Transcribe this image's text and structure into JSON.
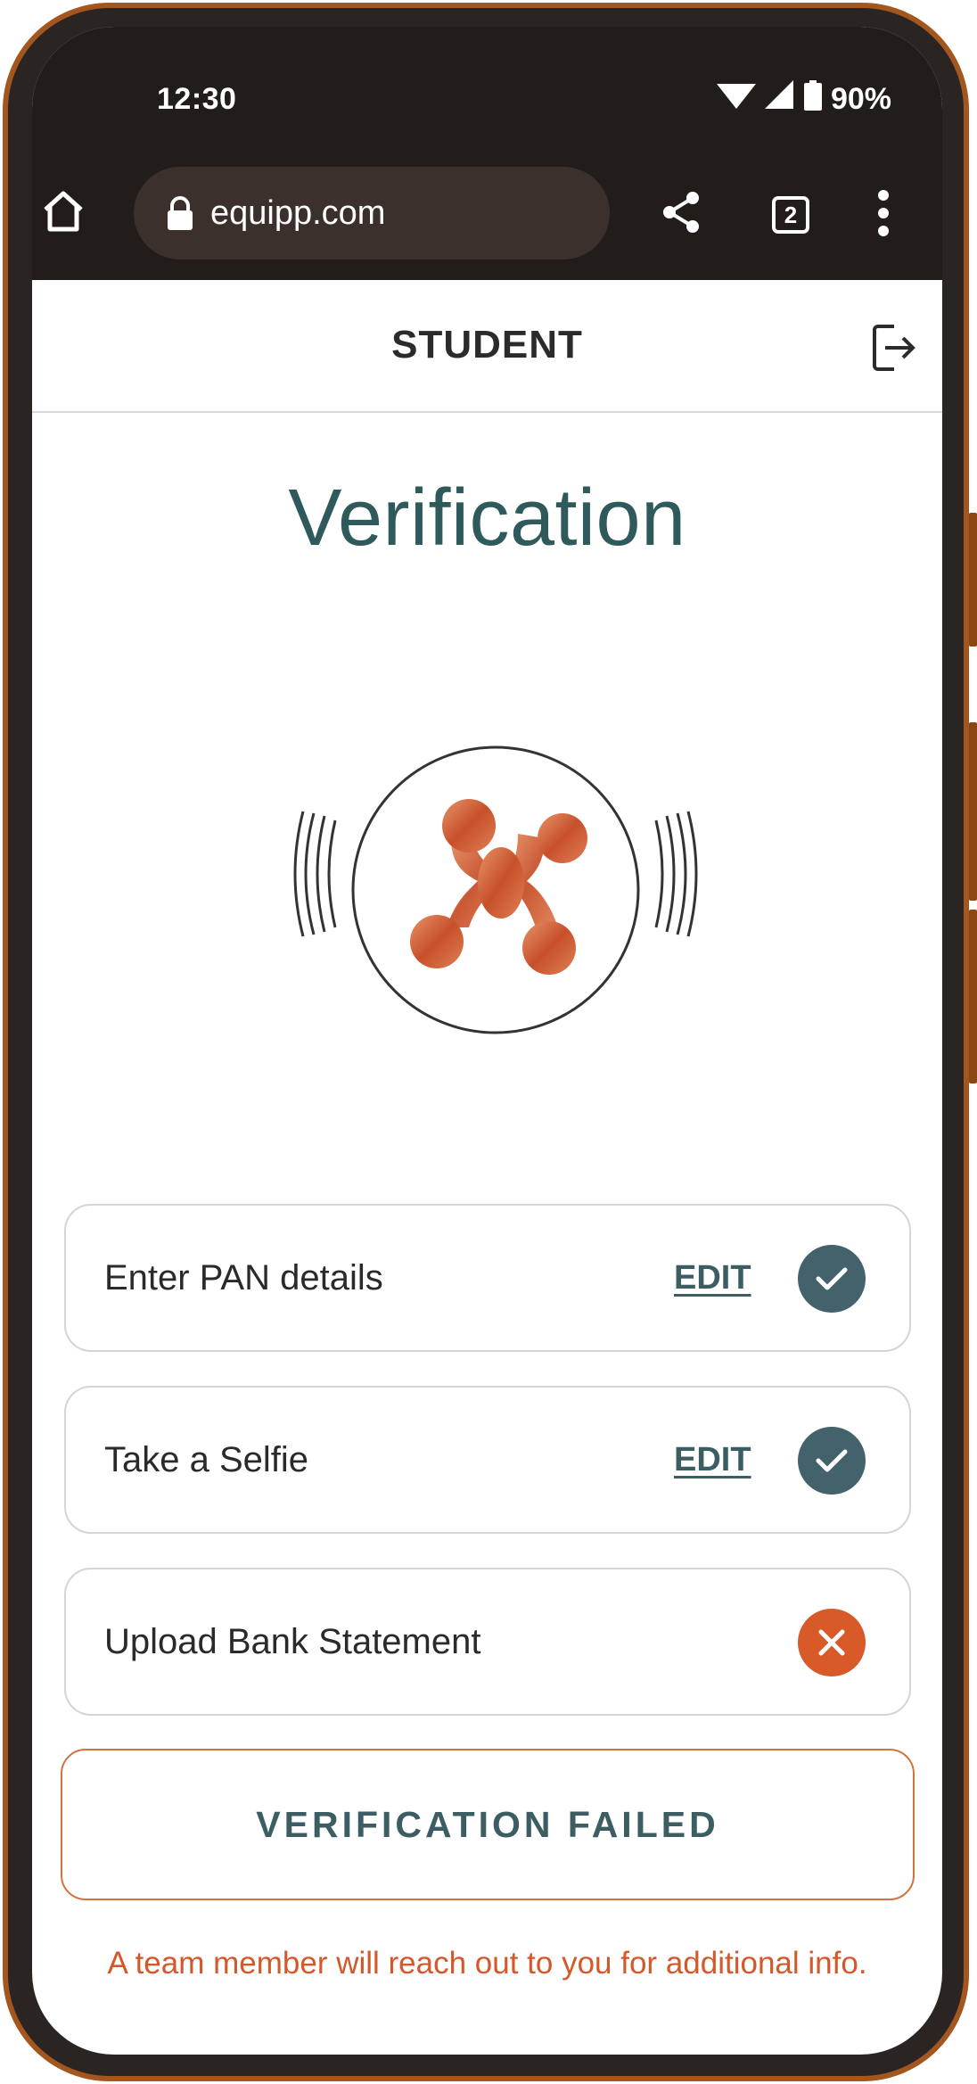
{
  "status_bar": {
    "time": "12:30",
    "battery": "90%"
  },
  "browser": {
    "url": "equipp.com",
    "tab_count": "2",
    "icons": [
      "home-icon",
      "lock-icon",
      "share-icon",
      "tabs-icon",
      "more-vert-icon"
    ]
  },
  "app_header": {
    "title": "STUDENT",
    "logout_icon": "logout-icon"
  },
  "page": {
    "title": "Verification"
  },
  "steps": [
    {
      "label": "Enter PAN details",
      "edit_label": "EDIT",
      "status": "complete"
    },
    {
      "label": "Take a Selfie",
      "edit_label": "EDIT",
      "status": "complete"
    },
    {
      "label": "Upload Bank Statement",
      "edit_label": "",
      "status": "failed"
    }
  ],
  "result": {
    "button_label": "VERIFICATION FAILED",
    "note": "A team member will reach out to you for additional info."
  },
  "colors": {
    "teal_text": "#2f5a5c",
    "check_bg": "#43626b",
    "fail_orange": "#d75a28",
    "frame_brown": "#a4561f"
  }
}
